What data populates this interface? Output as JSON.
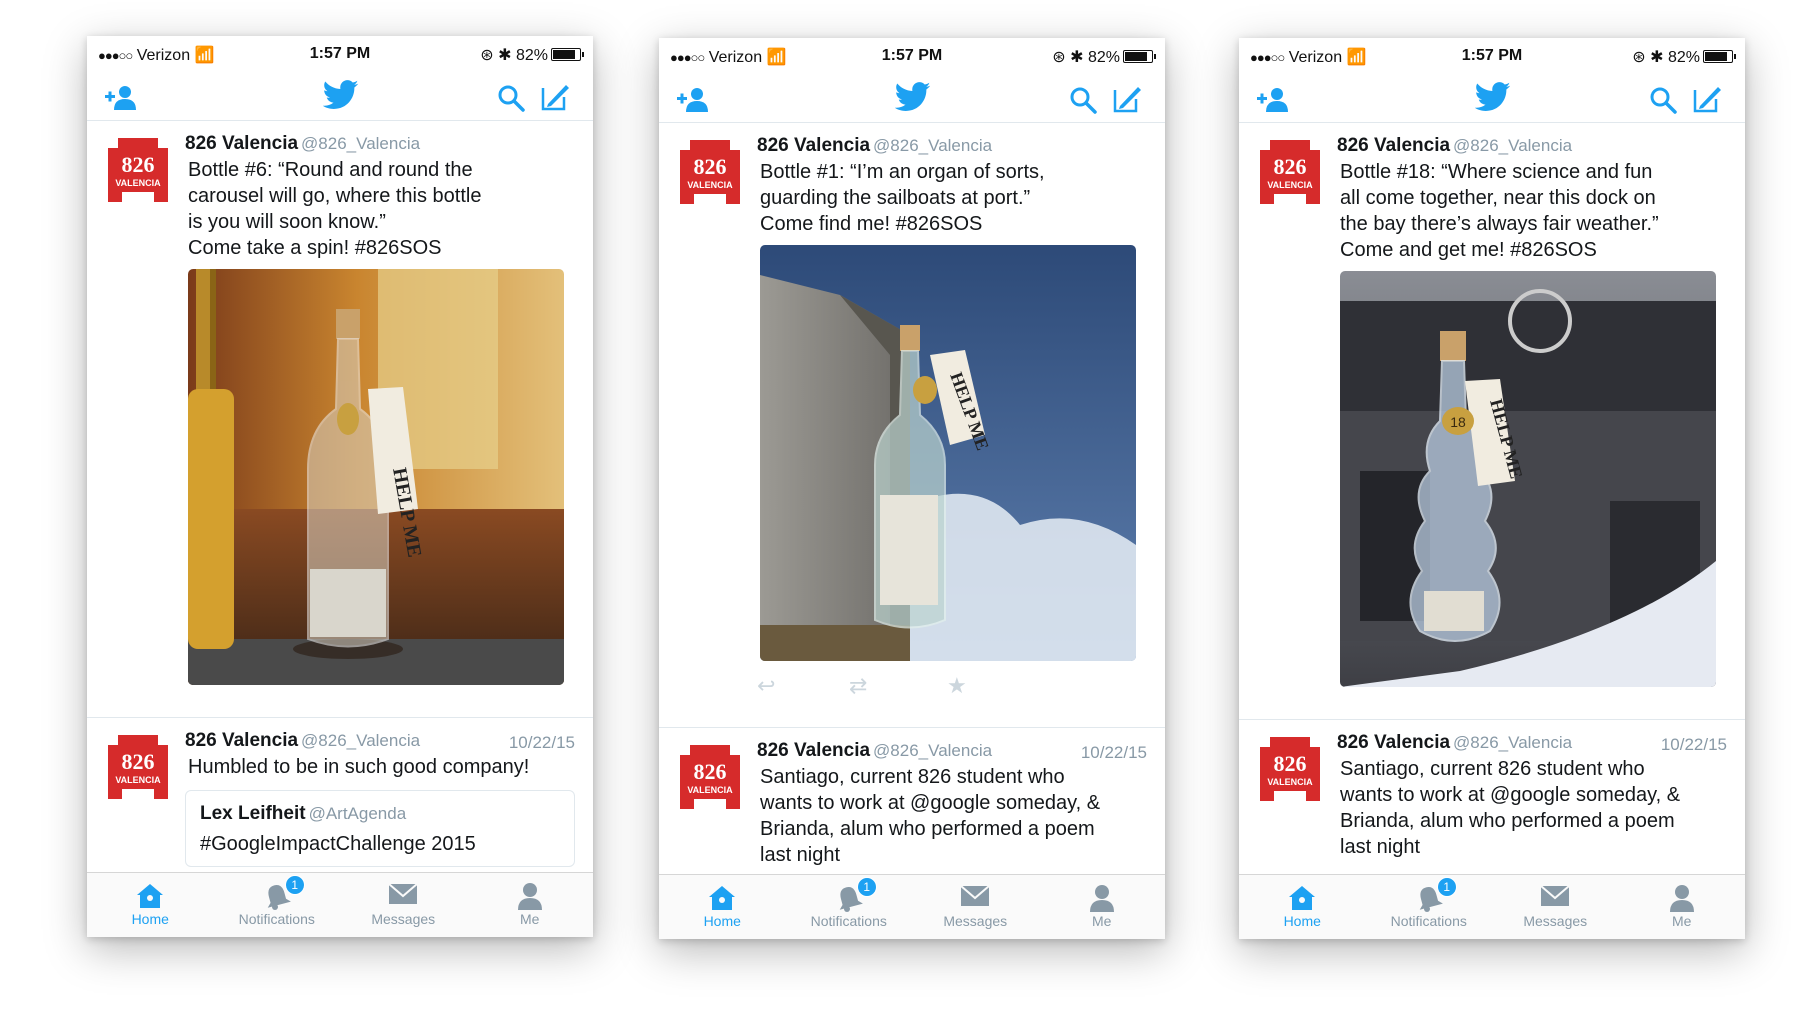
{
  "status": {
    "carrier": "Verizon",
    "time": "1:57 PM",
    "battery": "82%"
  },
  "account": {
    "name": "826 Valencia",
    "handle": "@826_Valencia",
    "avatar_number": "826",
    "avatar_word": "VALENCIA"
  },
  "tabs": {
    "home": "Home",
    "notifications": "Notifications",
    "messages": "Messages",
    "me": "Me",
    "badge": "1"
  },
  "colors": {
    "twitter_blue": "#1da1f2",
    "avatar_red": "#d62b2b"
  },
  "phones": [
    {
      "tweet1": {
        "lines": [
          "Bottle #6: “Round and round the",
          "carousel will go, where this bottle",
          "is you will soon know.”",
          "Come take a spin! #826SOS"
        ],
        "tag_text": "HELP ME"
      },
      "tweet2": {
        "date": "10/22/15",
        "lines": [
          "Humbled to be in such good company!"
        ],
        "quote": {
          "name": "Lex Leifheit",
          "handle": "@ArtAgenda",
          "text": "#GoogleImpactChallenge 2015"
        }
      }
    },
    {
      "tweet1": {
        "lines": [
          "Bottle #1: “I’m an organ of sorts,",
          "guarding the sailboats at port.”",
          "Come find me! #826SOS"
        ],
        "tag_text": "HELP ME"
      },
      "tweet2": {
        "date": "10/22/15",
        "lines": [
          "Santiago, current 826 student who",
          "wants to work at @google someday, &",
          "Brianda, alum who performed a poem",
          "last night"
        ]
      }
    },
    {
      "tweet1": {
        "lines": [
          "Bottle #18: “Where science and fun",
          "all come together, near this dock on",
          "the bay there’s always fair weather.”",
          "Come and get me! #826SOS"
        ],
        "tag_text": "HELP ME",
        "tag_number": "18"
      },
      "tweet2": {
        "date": "10/22/15",
        "lines": [
          "Santiago, current 826 student who",
          "wants to work at @google someday, &",
          "Brianda, alum who performed a poem",
          "last night"
        ]
      }
    }
  ]
}
